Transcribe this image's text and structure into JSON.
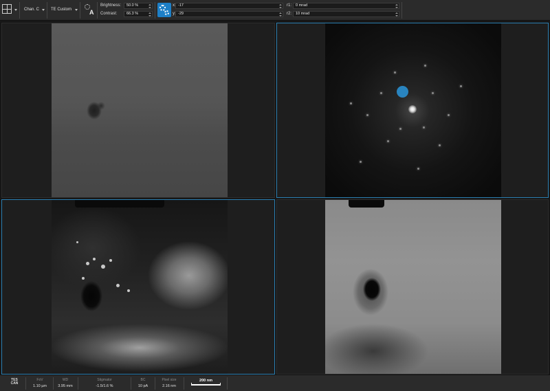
{
  "toolbar": {
    "channel": "Chan. C",
    "detector_mode": "TE Custom",
    "brightness": {
      "label": "Brightness:",
      "value": "50.0 %"
    },
    "contrast": {
      "label": "Contrast:",
      "value": "66.3 %"
    },
    "x": {
      "label": "x:",
      "value": "-17"
    },
    "y": {
      "label": "y:",
      "value": "-29"
    },
    "r1": {
      "label": "r1:",
      "value": "0 mrad"
    },
    "r2": {
      "label": "r2:",
      "value": "10 mrad"
    },
    "icons": [
      "layout-grid-icon",
      "auto-brightness-icon",
      "gears-icon"
    ],
    "accent_color": "#1d7fc6"
  },
  "viewer": {
    "active_border_color": "#2b7fb2",
    "panels": [
      "bright-field",
      "diffraction-pattern",
      "dark-field",
      "annular-dark-field"
    ]
  },
  "statusbar": {
    "logo": "TESCAN",
    "fov": {
      "label": "FoV",
      "value": "1.10 µm"
    },
    "wd": {
      "label": "WD",
      "value": "3.95 mm"
    },
    "stigmator": {
      "label": "Stigmator",
      "value": "-1.5/1.6 %"
    },
    "bc": {
      "label": "BC",
      "value": "10 pA"
    },
    "pixel_size": {
      "label": "Pixel size",
      "value": "2.16 nm"
    },
    "scale_bar": "200 nm"
  }
}
